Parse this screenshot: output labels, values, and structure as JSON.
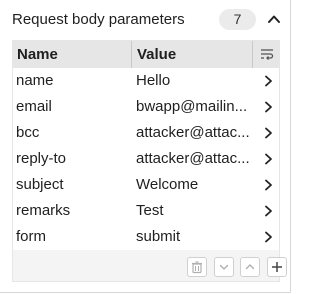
{
  "panel": {
    "title": "Request body parameters",
    "count": "7",
    "icons": {
      "collapse": "chevron-up-icon",
      "wrap": "wrap-text-icon",
      "row": "chevron-right-icon"
    }
  },
  "table": {
    "columns": {
      "name": "Name",
      "value": "Value"
    },
    "rows": [
      {
        "name": "name",
        "value": "Hello"
      },
      {
        "name": "email",
        "value": "bwapp@mailin..."
      },
      {
        "name": "bcc",
        "value": "attacker@attac..."
      },
      {
        "name": "reply-to",
        "value": "attacker@attac..."
      },
      {
        "name": "subject",
        "value": "Welcome"
      },
      {
        "name": "remarks",
        "value": "Test"
      },
      {
        "name": "form",
        "value": "submit"
      }
    ]
  },
  "toolbar": {
    "buttons": [
      "trash-icon",
      "chevron-down-icon",
      "chevron-up-icon",
      "plus-icon"
    ]
  },
  "colors": {
    "header_bg": "#e6e6e6",
    "panel_bg": "#f4f4f4",
    "text": "#1f1f1f"
  }
}
